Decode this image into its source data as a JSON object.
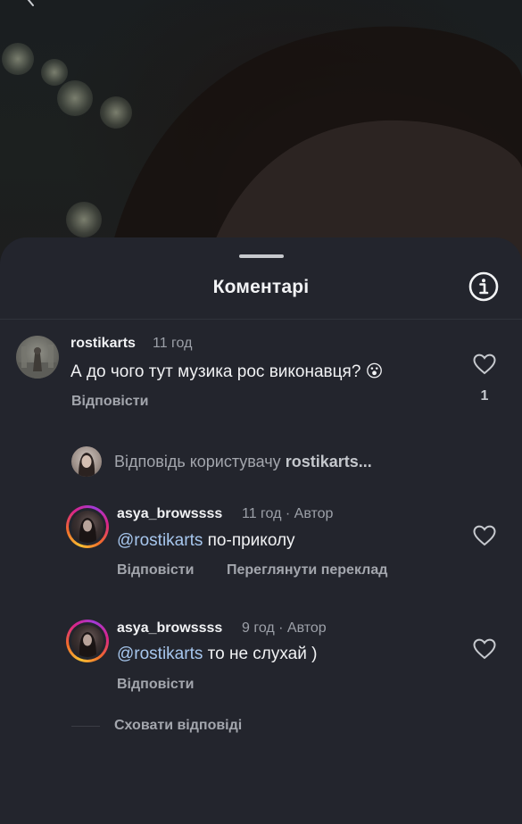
{
  "sheet": {
    "title": "Коментарі"
  },
  "comments": [
    {
      "username": "rostikarts",
      "time": "11 год",
      "text": "А до чого тут музика рос виконавця? 😮",
      "reply_label": "Відповісти",
      "like_count": "1"
    }
  ],
  "reply_bar": {
    "prefix": "Відповідь користувачу",
    "target": "rostikarts..."
  },
  "replies": [
    {
      "username": "asya_browssss",
      "meta": "11 год · Автор",
      "mention": "@rostikarts",
      "text": " по-приколу",
      "reply_label": "Відповісти",
      "translate_label": "Переглянути переклад"
    },
    {
      "username": "asya_browssss",
      "meta": "9 год · Автор",
      "mention": "@rostikarts",
      "text": " то не слухай )",
      "reply_label": "Відповісти"
    }
  ],
  "hide_replies_label": "Сховати відповіді",
  "colors": {
    "sheet_bg": "#23252d",
    "mention": "#a7c7ee",
    "muted_text": "#a3a6ad"
  }
}
